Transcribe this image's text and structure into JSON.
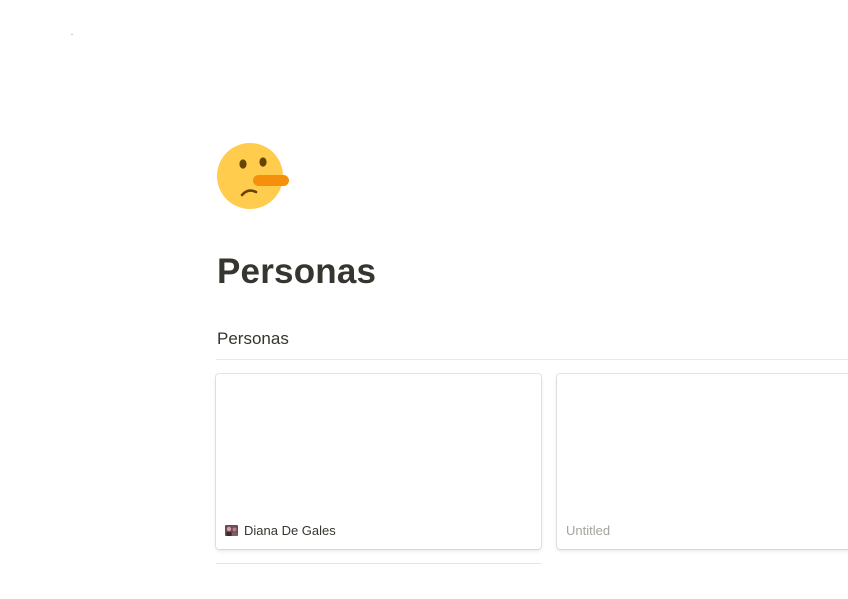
{
  "page": {
    "icon": "lying-face-emoji-icon",
    "title": "Personas"
  },
  "database": {
    "title": "Personas",
    "cards": [
      {
        "icon": "persona-avatar-icon",
        "name": "Diana De Gales",
        "placeholder": false
      },
      {
        "icon": null,
        "name": "Untitled",
        "placeholder": true
      }
    ]
  },
  "colors": {
    "text": "#37352f",
    "placeholder_text": "#a5a49f",
    "divider": "#e9e9e7",
    "emoji_face": "#ffcc4d",
    "emoji_nose": "#f4900c"
  }
}
